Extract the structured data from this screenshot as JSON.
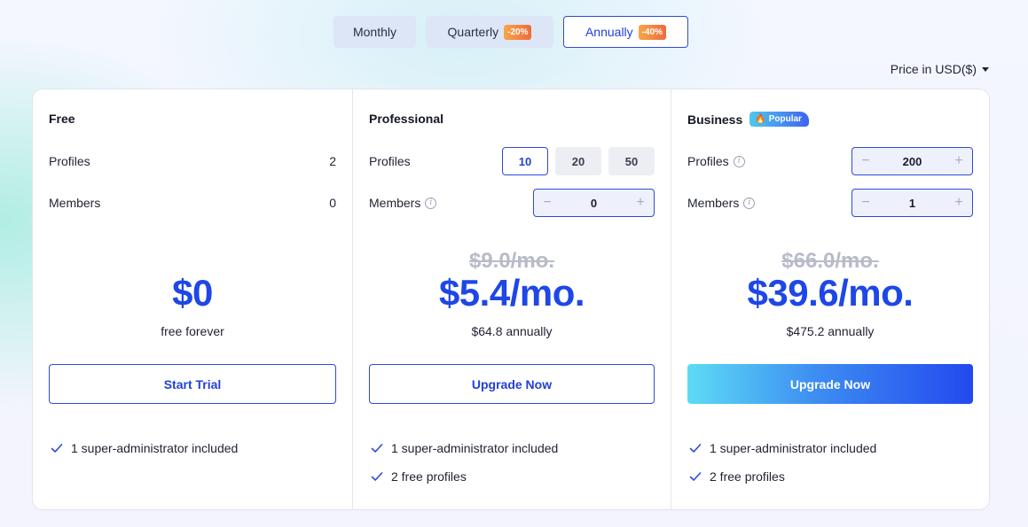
{
  "period_tabs": [
    {
      "label": "Monthly",
      "discount": ""
    },
    {
      "label": "Quarterly",
      "discount": "-20%"
    },
    {
      "label": "Annually",
      "discount": "-40%"
    }
  ],
  "selected_period": "Annually",
  "currency": {
    "label": "Price in USD($)"
  },
  "plans": {
    "free": {
      "title": "Free",
      "profiles_label": "Profiles",
      "profiles_value": "2",
      "members_label": "Members",
      "members_value": "0",
      "price": "$0",
      "price_sub": "free forever",
      "cta": "Start Trial",
      "features": [
        "1 super-administrator included"
      ]
    },
    "pro": {
      "title": "Professional",
      "profiles_label": "Profiles",
      "profile_options": [
        "10",
        "20",
        "50"
      ],
      "selected_profiles": "10",
      "members_label": "Members",
      "members_value": "0",
      "old_price": "$9.0/mo.",
      "price": "$5.4/mo.",
      "price_sub": "$64.8 annually",
      "cta": "Upgrade Now",
      "features": [
        "1 super-administrator included",
        "2 free profiles"
      ]
    },
    "biz": {
      "title": "Business",
      "badge": "Popular",
      "profiles_label": "Profiles",
      "profiles_value": "200",
      "members_label": "Members",
      "members_value": "1",
      "old_price": "$66.0/mo.",
      "price": "$39.6/mo.",
      "price_sub": "$475.2 annually",
      "cta": "Upgrade Now",
      "features": [
        "1 super-administrator included",
        "2 free profiles"
      ]
    }
  },
  "icons": {
    "minus": "−",
    "plus": "+",
    "info": "i",
    "fire": "🔥"
  },
  "colors": {
    "accent": "#2340d8",
    "price": "#1e47e6",
    "discount_start": "#f6a64a",
    "discount_end": "#f06a3a"
  }
}
